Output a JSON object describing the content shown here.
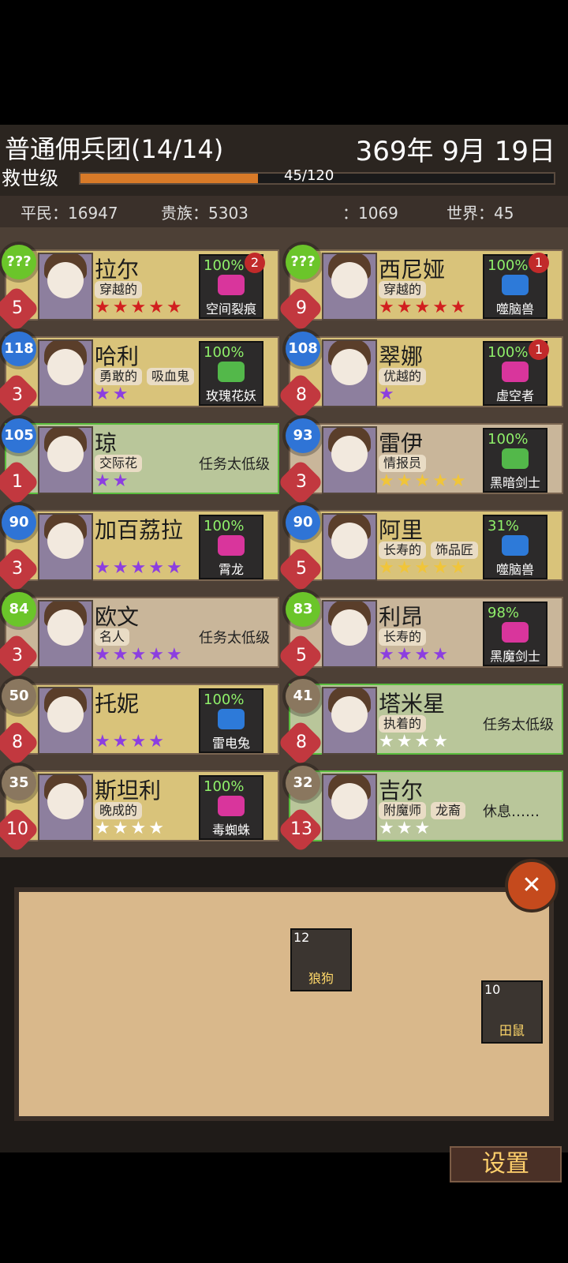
{
  "header": {
    "guild": "普通佣兵团(14/14)",
    "date": "369年 9月 19日",
    "rank": "救世级",
    "xp_text": "45/120",
    "xp_progress": 0.375
  },
  "stats": {
    "commoners_label": "平民",
    "commoners": "16947",
    "nobles_label": "贵族",
    "nobles": "5303",
    "third_value": "1069",
    "world_label": "世界",
    "world": "45"
  },
  "mercs": [
    {
      "name": "拉尔",
      "tags": [
        "穿越的"
      ],
      "stars": 5,
      "star_color": "#d11f1f",
      "badge": "???",
      "badge_color": "lime",
      "level": "5",
      "pct": "100%",
      "mission": "空间裂痕",
      "bubble": "2",
      "card_style": "highlight"
    },
    {
      "name": "西尼娅",
      "tags": [
        "穿越的"
      ],
      "stars": 5,
      "star_color": "#d11f1f",
      "badge": "???",
      "badge_color": "lime",
      "level": "9",
      "pct": "100%",
      "mission": "噬脑兽",
      "bubble": "1",
      "card_style": "highlight"
    },
    {
      "name": "哈利",
      "tags": [
        "勇敢的",
        "吸血鬼"
      ],
      "stars": 2,
      "star_color": "#8c3ee0",
      "badge": "118",
      "badge_color": "blue",
      "level": "3",
      "pct": "100%",
      "mission": "玫瑰花妖",
      "bubble": "",
      "card_style": "highlight"
    },
    {
      "name": "翠娜",
      "tags": [
        "优越的"
      ],
      "stars": 1,
      "star_color": "#8c3ee0",
      "badge": "108",
      "badge_color": "blue",
      "level": "8",
      "pct": "100%",
      "mission": "虚空者",
      "bubble": "1",
      "card_style": "highlight"
    },
    {
      "name": "琼",
      "tags": [
        "交际花"
      ],
      "stars": 2,
      "star_color": "#8c3ee0",
      "badge": "105",
      "badge_color": "blue",
      "level": "1",
      "pct": "",
      "mission": "",
      "lowmsg": "任务太低级",
      "bubble": "",
      "card_style": "green"
    },
    {
      "name": "雷伊",
      "tags": [
        "情报员"
      ],
      "stars": 5,
      "star_color": "#f0c53a",
      "badge": "93",
      "badge_color": "blue",
      "level": "3",
      "pct": "100%",
      "mission": "黑暗剑士",
      "bubble": "",
      "card_style": "normal"
    },
    {
      "name": "加百荔拉",
      "tags": [],
      "stars": 5,
      "star_color": "#8c3ee0",
      "badge": "90",
      "badge_color": "blue",
      "level": "3",
      "pct": "100%",
      "mission": "霄龙",
      "bubble": "",
      "card_style": "highlight"
    },
    {
      "name": "阿里",
      "tags": [
        "长寿的",
        "饰品匠"
      ],
      "stars": 5,
      "star_color": "#f0c53a",
      "badge": "90",
      "badge_color": "blue",
      "level": "5",
      "pct": "31%",
      "mission": "噬脑兽",
      "bubble": "",
      "card_style": "highlight"
    },
    {
      "name": "欧文",
      "tags": [
        "名人"
      ],
      "stars": 5,
      "star_color": "#8c3ee0",
      "badge": "84",
      "badge_color": "lime",
      "level": "3",
      "pct": "",
      "mission": "",
      "lowmsg": "任务太低级",
      "bubble": "",
      "card_style": "normal"
    },
    {
      "name": "利昂",
      "tags": [
        "长寿的"
      ],
      "stars": 4,
      "star_color": "#8c3ee0",
      "badge": "83",
      "badge_color": "lime",
      "level": "5",
      "pct": "98%",
      "mission": "黑魔剑士",
      "bubble": "",
      "card_style": "normal"
    },
    {
      "name": "托妮",
      "tags": [],
      "stars": 4,
      "star_color": "#8c3ee0",
      "badge": "50",
      "badge_color": "tan",
      "level": "8",
      "pct": "100%",
      "mission": "雷电兔",
      "bubble": "",
      "card_style": "highlight"
    },
    {
      "name": "塔米星",
      "tags": [
        "执着的"
      ],
      "stars": 4,
      "star_color": "#ffffff",
      "badge": "41",
      "badge_color": "tan",
      "level": "8",
      "pct": "",
      "mission": "",
      "lowmsg": "任务太低级",
      "bubble": "",
      "card_style": "green"
    },
    {
      "name": "斯坦利",
      "tags": [
        "晚成的"
      ],
      "stars": 4,
      "star_color": "#ffffff",
      "badge": "35",
      "badge_color": "tan",
      "level": "10",
      "pct": "100%",
      "mission": "毒蜘蛛",
      "bubble": "",
      "card_style": "highlight"
    },
    {
      "name": "吉尔",
      "tags": [
        "附魔师",
        "龙裔"
      ],
      "stars": 3,
      "star_color": "#ffffff",
      "badge": "32",
      "badge_color": "tan",
      "level": "13",
      "pct": "",
      "mission": "",
      "lowmsg": "休息……",
      "bubble": "",
      "card_style": "green"
    }
  ],
  "drops": [
    {
      "count": "12",
      "name": "狼狗"
    },
    {
      "count": "10",
      "name": "田鼠"
    }
  ],
  "footer": {
    "settings": "设置"
  }
}
